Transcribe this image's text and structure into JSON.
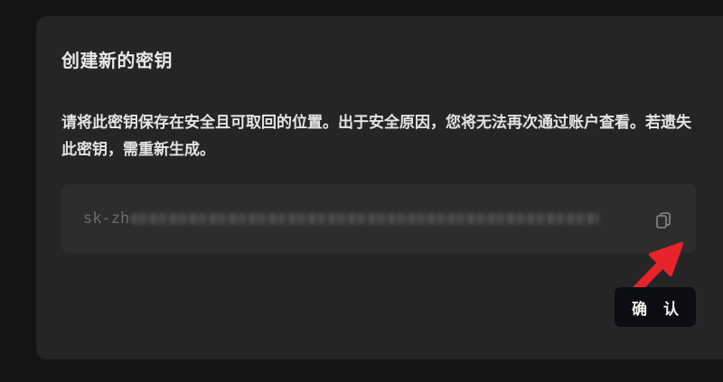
{
  "dialog": {
    "title": "创建新的密钥",
    "description": "请将此密钥保存在安全且可取回的位置。出于安全原因，您将无法再次通过账户查看。若遗失此密钥，需重新生成。",
    "key": {
      "visible_prefix": "sk-zh"
    },
    "copy_icon": "copy-icon",
    "confirm_label": "确 认"
  },
  "colors": {
    "page_background": "#141414",
    "dialog_background": "#252525",
    "key_box_background": "#2d2d2d",
    "confirm_button": "#0c0d12",
    "annotation_arrow": "#e8232b"
  }
}
